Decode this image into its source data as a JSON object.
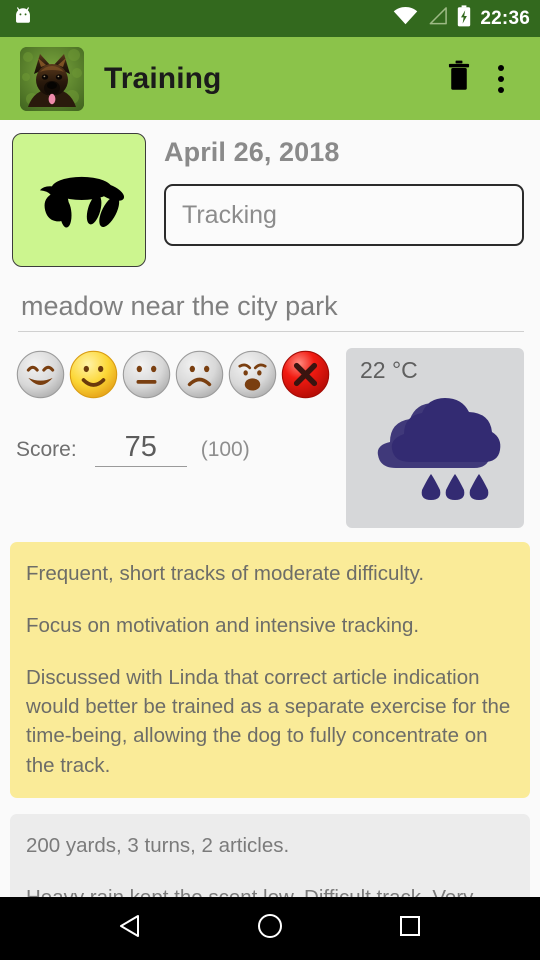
{
  "status_bar": {
    "notification_icon": "android-robot-icon",
    "wifi_icon": "wifi-full-icon",
    "cellular_icon": "cellular-no-signal-icon",
    "battery_icon": "battery-charging-icon",
    "clock": "22:36",
    "background_color": "#33691e"
  },
  "app_bar": {
    "avatar_icon": "dog-photo-avatar",
    "title": "Training",
    "delete_icon": "trash-icon",
    "overflow_icon": "more-vertical-icon",
    "background_color": "#8bc34a"
  },
  "entry": {
    "type_icon": "dog-silhouette-icon",
    "type_icon_background": "#ccf58f",
    "date": "April 26, 2018",
    "activity": "Tracking",
    "activity_placeholder": "Tracking",
    "location": "meadow near the city park",
    "location_placeholder": "Location"
  },
  "mood": {
    "selected_index": 1,
    "options": [
      {
        "name": "mood-very-happy-icon",
        "label": "Very happy",
        "selected": false
      },
      {
        "name": "mood-happy-icon",
        "label": "Happy",
        "selected": true
      },
      {
        "name": "mood-neutral-icon",
        "label": "Neutral",
        "selected": false
      },
      {
        "name": "mood-sad-icon",
        "label": "Sad",
        "selected": false
      },
      {
        "name": "mood-worried-icon",
        "label": "Worried",
        "selected": false
      },
      {
        "name": "mood-clear-icon",
        "label": "Clear",
        "selected": false
      }
    ]
  },
  "score": {
    "label": "Score:",
    "value": "75",
    "max": "(100)"
  },
  "weather": {
    "temperature": "22 °C",
    "icon": "rain-cloud-icon",
    "icon_color": "#332b72",
    "card_color": "#d6d7d9"
  },
  "notes": {
    "plan_card": {
      "color": "#faeb98",
      "paragraphs": [
        "Frequent, short tracks of moderate difficulty.",
        "Focus on motivation and intensive tracking.",
        "Discussed with Linda that correct article indication would better be trained as a separate exercise for the time-being, allowing the dog to fully concentrate on the track."
      ]
    },
    "report_card": {
      "color": "#ececec",
      "paragraphs": [
        "200 yards, 3 turns, 2 articles.",
        "Heavy rain kept the scent low. Difficult track. Very intensive tracking, dog highly motivated and"
      ]
    }
  },
  "nav_bar": {
    "back_icon": "back-triangle-icon",
    "home_icon": "home-circle-icon",
    "recents_icon": "recents-square-icon"
  }
}
